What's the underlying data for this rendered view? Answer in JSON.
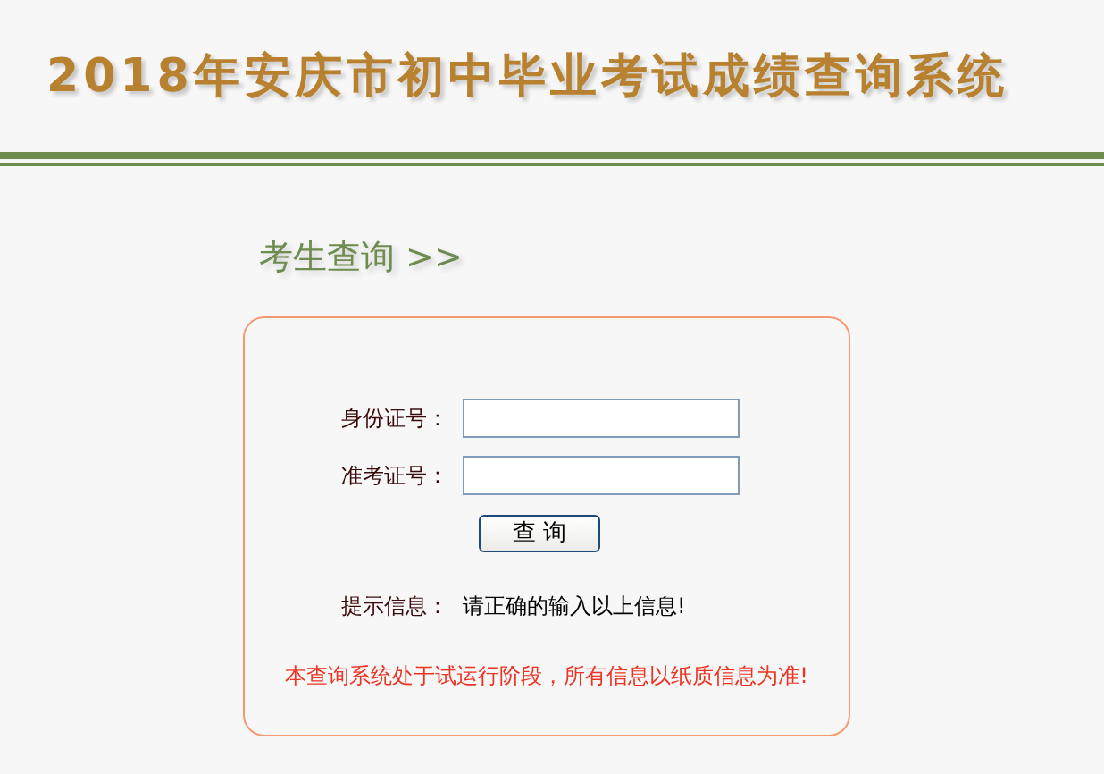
{
  "title": "2018年安庆市初中毕业考试成绩查询系统",
  "section_heading": "考生查询 >>",
  "form": {
    "fields": [
      {
        "label": "身份证号："
      },
      {
        "label": "准考证号："
      }
    ],
    "submit": "查 询",
    "hint": {
      "label": "提示信息：",
      "text": "请正确的输入以上信息!"
    },
    "notice": "本查询系统处于试运行阶段，所有信息以纸质信息为准!"
  }
}
